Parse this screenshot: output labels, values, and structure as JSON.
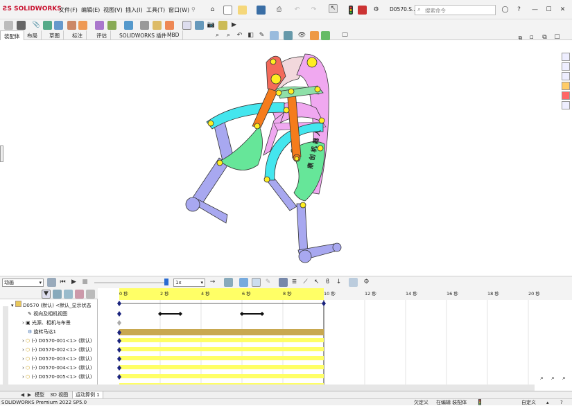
{
  "app": {
    "logo_text": "SOLIDWORKS"
  },
  "menu": [
    "文件(F)",
    "编辑(E)",
    "视图(V)",
    "插入(I)",
    "工具(T)",
    "窗口(W)"
  ],
  "document_name": "D0570.S...",
  "search": {
    "placeholder": "搜索命令"
  },
  "tabs": [
    "装配体",
    "布局",
    "草图",
    "标注",
    "评估",
    "SOLIDWORKS 插件",
    "MBD"
  ],
  "model_text": "鼎 创 机 器 人",
  "animation": {
    "mode": "动画",
    "playback_speed": "1x"
  },
  "timeline": {
    "ticks": [
      "0 秒",
      "2 秒",
      "4 秒",
      "6 秒",
      "8 秒",
      "10 秒",
      "12 秒",
      "14 秒",
      "16 秒",
      "18 秒",
      "20 秒"
    ]
  },
  "tree": {
    "root": "D0570 (默认) <默认_显示状态",
    "items": [
      "视向及相机视图",
      "光源、相机与布景",
      "旋转马达1",
      "(-) D0570-001<1> (默认)",
      "(-) D0570-002<1> (默认)",
      "(-) D0570-003<1> (默认)",
      "(-) D0570-004<1> (默认)",
      "(-) D0570-005<1> (默认)"
    ]
  },
  "bottom_tabs": [
    "模型",
    "3D 视图",
    "运动算例 1"
  ],
  "status": {
    "product": "SOLIDWORKS Premium 2022 SP5.0",
    "definition": "欠定义",
    "editing": "在编辑 装配体",
    "custom": "自定义"
  },
  "colors": {
    "timeline_yellow": "#ffff66",
    "timeline_gold": "#c8a850",
    "accent_red": "#c8102e",
    "key_diamond": "#1a237e"
  }
}
